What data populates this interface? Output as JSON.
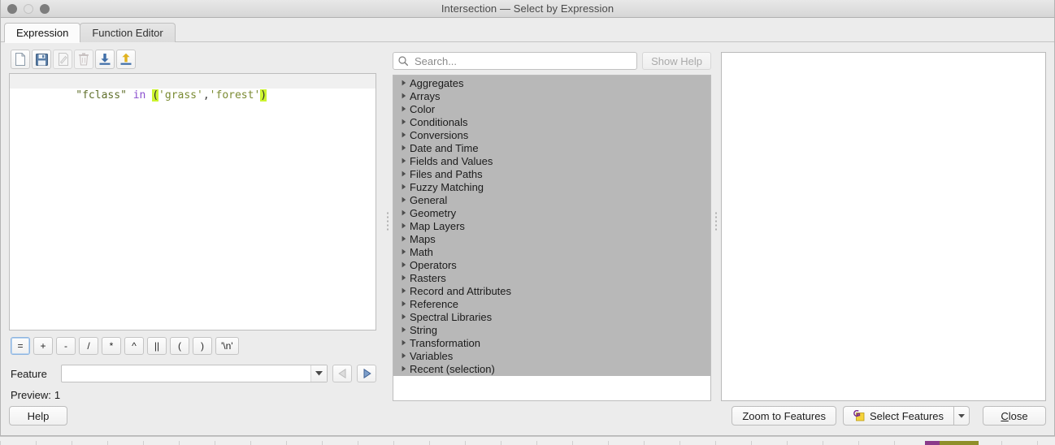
{
  "window": {
    "title": "Intersection — Select by Expression",
    "controls": [
      "close-button",
      "minimize-button",
      "zoom-button"
    ]
  },
  "tabs": [
    {
      "label": "Expression",
      "active": true
    },
    {
      "label": "Function Editor",
      "active": false
    }
  ],
  "expression_toolbar": {
    "buttons": [
      {
        "name": "new-expression-button",
        "icon": "document-icon",
        "enabled": true
      },
      {
        "name": "save-expression-button",
        "icon": "floppy-disk-icon",
        "enabled": true
      },
      {
        "name": "edit-expression-button",
        "icon": "pencil-icon",
        "enabled": false
      },
      {
        "name": "delete-expression-button",
        "icon": "trash-icon",
        "enabled": false
      },
      {
        "name": "import-expressions-button",
        "icon": "import-down-arrow-icon",
        "enabled": true
      },
      {
        "name": "export-expressions-button",
        "icon": "export-up-arrow-icon",
        "enabled": true
      }
    ]
  },
  "expression": {
    "full_text": "\"fclass\" in ('grass','forest')",
    "tokens": [
      {
        "text": "\"fclass\"",
        "kind": "field"
      },
      {
        "text": " ",
        "kind": "plain"
      },
      {
        "text": "in",
        "kind": "keyword"
      },
      {
        "text": " ",
        "kind": "plain"
      },
      {
        "text": "(",
        "kind": "paren-highlight"
      },
      {
        "text": "'grass'",
        "kind": "string"
      },
      {
        "text": ",",
        "kind": "punct"
      },
      {
        "text": "'forest'",
        "kind": "string"
      },
      {
        "text": ")",
        "kind": "paren-highlight"
      }
    ]
  },
  "operators": [
    {
      "label": "=",
      "focused": true
    },
    {
      "label": "+",
      "focused": false
    },
    {
      "label": "-",
      "focused": false
    },
    {
      "label": "/",
      "focused": false
    },
    {
      "label": "*",
      "focused": false
    },
    {
      "label": "^",
      "focused": false
    },
    {
      "label": "||",
      "focused": false
    },
    {
      "label": "(",
      "focused": false
    },
    {
      "label": ")",
      "focused": false
    },
    {
      "label": "'\\n'",
      "focused": false
    }
  ],
  "feature": {
    "label": "Feature",
    "value": "",
    "placeholder": "",
    "prev_enabled": false,
    "next_enabled": true
  },
  "preview": {
    "label": "Preview:",
    "value": "1"
  },
  "search": {
    "placeholder": "Search...",
    "value": "",
    "icon": "search-icon"
  },
  "show_help": {
    "label": "Show Help",
    "enabled": false
  },
  "function_tree": {
    "items": [
      "Aggregates",
      "Arrays",
      "Color",
      "Conditionals",
      "Conversions",
      "Date and Time",
      "Fields and Values",
      "Files and Paths",
      "Fuzzy Matching",
      "General",
      "Geometry",
      "Map Layers",
      "Maps",
      "Math",
      "Operators",
      "Rasters",
      "Record and Attributes",
      "Reference",
      "Spectral Libraries",
      "String",
      "Transformation",
      "Variables",
      "Recent (selection)"
    ]
  },
  "help_panel": {
    "content": ""
  },
  "bottom_bar": {
    "help_label": "Help",
    "zoom_to_features_label": "Zoom to Features",
    "select_features_label": "Select Features",
    "select_features_icon": "select-features-icon",
    "close_label": "Close",
    "close_mnemonic": "C"
  },
  "colors": {
    "dialog_background": "#ececec",
    "tree_selection": "#b8b8b8",
    "expression_field": "#5f6f2a",
    "expression_keyword": "#8a4fcf",
    "expression_string": "#7b8b33",
    "paren_highlight": "#ccf430",
    "accent_blue": "#4a76b8",
    "icon_yellow": "#f5d33b",
    "icon_purple": "#7b2d8e"
  }
}
